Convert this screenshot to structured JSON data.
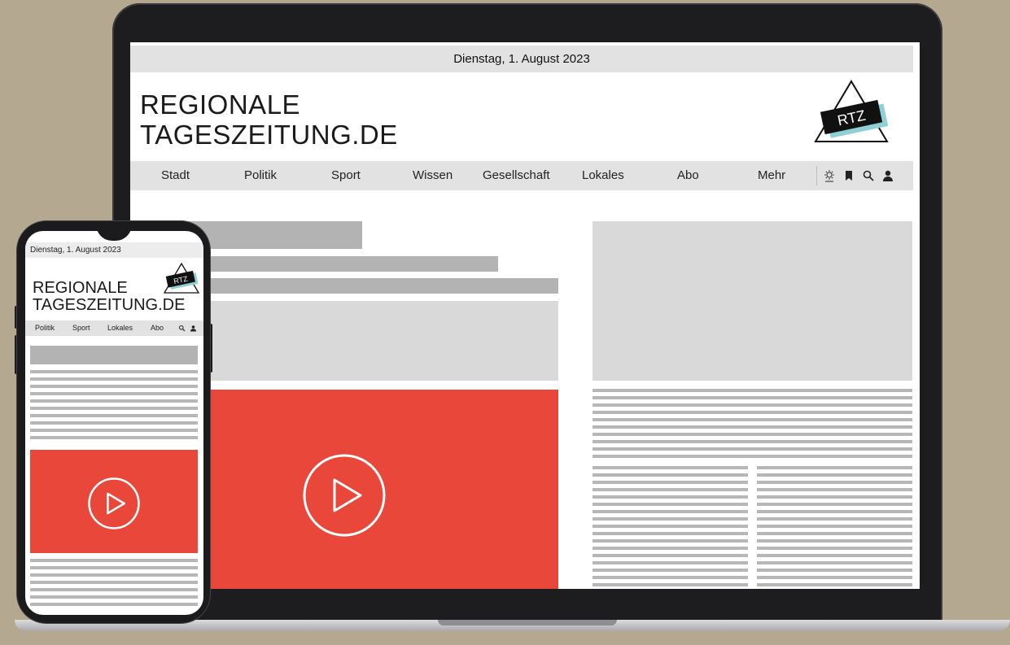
{
  "desktop": {
    "date": "Dienstag, 1. August 2023",
    "title_line1": "REGIONALE",
    "title_line2": "TAGESZEITUNG.DE",
    "logo_text": "RTZ",
    "nav": {
      "items": [
        "Stadt",
        "Politik",
        "Sport",
        "Wissen",
        "Gesellschaft",
        "Lokales",
        "Abo",
        "Mehr"
      ],
      "icons": [
        "weather-icon",
        "bookmark-icon",
        "search-icon",
        "user-icon"
      ]
    }
  },
  "mobile": {
    "date": "Dienstag, 1. August 2023",
    "title_line1": "REGIONALE",
    "title_line2": "TAGESZEITUNG.DE",
    "logo_text": "RTZ",
    "nav": {
      "items": [
        "Politik",
        "Sport",
        "Lokales",
        "Abo"
      ],
      "icons": [
        "search-icon",
        "user-icon"
      ]
    }
  },
  "colors": {
    "accent_red": "#e8473a",
    "background": "#b5a891",
    "placeholder_dark": "#b3b3b3",
    "placeholder_light": "#d9d9d9"
  }
}
